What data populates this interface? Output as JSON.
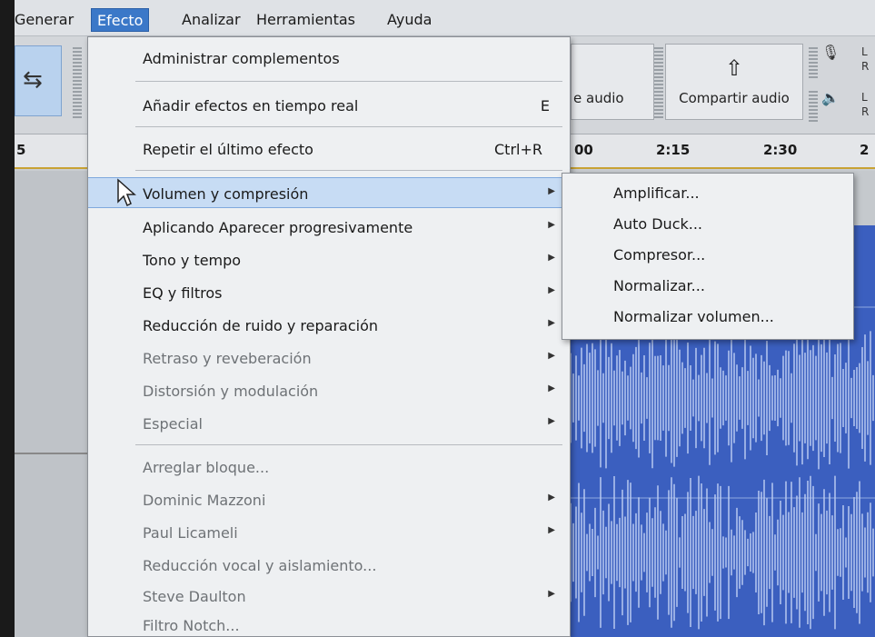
{
  "menubar": {
    "items": [
      "Generar",
      "Efecto",
      "Analizar",
      "Herramientas",
      "Ayuda"
    ],
    "active": "Efecto"
  },
  "toolbar": {
    "audio_label": "e audio",
    "share_label": "Compartir audio",
    "channel_left": "L",
    "channel_right": "R"
  },
  "timeline": {
    "ticks": [
      "5",
      "00",
      "2:15",
      "2:30",
      "2"
    ]
  },
  "effect_menu": {
    "items": [
      {
        "label": "Administrar complementos",
        "shortcut": "",
        "submenu": false
      },
      {
        "label": "Añadir efectos en tiempo real",
        "shortcut": "E",
        "submenu": false
      },
      {
        "label": "Repetir el último efecto",
        "shortcut": "Ctrl+R",
        "submenu": false
      },
      {
        "label": "Volumen y compresión",
        "shortcut": "",
        "submenu": true
      },
      {
        "label": "Aplicando Aparecer progresivamente",
        "shortcut": "",
        "submenu": true
      },
      {
        "label": "Tono y tempo",
        "shortcut": "",
        "submenu": true
      },
      {
        "label": "EQ y filtros",
        "shortcut": "",
        "submenu": true
      },
      {
        "label": "Reducción de ruido y reparación",
        "shortcut": "",
        "submenu": true
      },
      {
        "label": "Retraso y reveberación",
        "shortcut": "",
        "submenu": true
      },
      {
        "label": "Distorsión y modulación",
        "shortcut": "",
        "submenu": true
      },
      {
        "label": "Especial",
        "shortcut": "",
        "submenu": true
      },
      {
        "label": "Arreglar bloque...",
        "shortcut": "",
        "submenu": false
      },
      {
        "label": "Dominic Mazzoni",
        "shortcut": "",
        "submenu": true
      },
      {
        "label": "Paul Licameli",
        "shortcut": "",
        "submenu": true
      },
      {
        "label": "Reducción vocal y aislamiento...",
        "shortcut": "",
        "submenu": false
      },
      {
        "label": "Steve Daulton",
        "shortcut": "",
        "submenu": true
      },
      {
        "label": "Filtro Notch...",
        "shortcut": "",
        "submenu": false
      }
    ],
    "selected": "Volumen y compresión"
  },
  "sub_menu": {
    "items": [
      "Amplificar...",
      "Auto Duck...",
      "Compresor...",
      "Normalizar...",
      "Normalizar volumen..."
    ]
  },
  "colors": {
    "menu_active": "#3b78c8",
    "selection": "#c7dcf4",
    "waveform": "#3b5fbf"
  },
  "icons": {
    "loop": "loop-icon",
    "share": "share-upload-icon",
    "mic": "microphone-icon",
    "speaker": "speaker-icon",
    "submenu_arrow": "chevron-right-icon",
    "cursor": "mouse-pointer-icon"
  }
}
